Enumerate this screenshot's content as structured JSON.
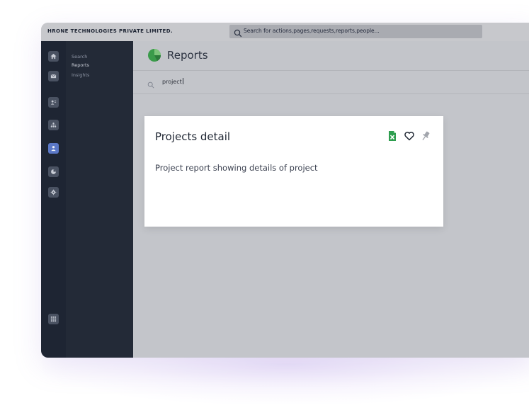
{
  "topbar": {
    "company": "HRONE TECHNOLOGIES PRIVATE LIMITED.",
    "search_placeholder": "Search for actions,pages,requests,reports,people..."
  },
  "rail": {
    "icons": [
      "home-icon",
      "mail-icon",
      "user-card-icon",
      "org-chart-icon",
      "person-icon",
      "pie-chart-icon",
      "settings-icon",
      "apps-grid-icon"
    ],
    "active_index": 4
  },
  "subnav": {
    "items": [
      {
        "label": "Search"
      },
      {
        "label": "Reports"
      },
      {
        "label": "Insights"
      }
    ],
    "active_index": 1
  },
  "page": {
    "title": "Reports"
  },
  "search": {
    "value": "project"
  },
  "card": {
    "title": "Projects detail",
    "description": "Project report showing details of project",
    "actions": [
      "excel-file-icon",
      "heart-icon",
      "pin-icon"
    ]
  },
  "colors": {
    "rail_bg": "#1e2533",
    "subnav_bg": "#232a37",
    "content_bg": "#c3c5ca",
    "accent": "#5b78c7",
    "reports_logo": "#3a9b4a",
    "excel_green": "#2e9e4f"
  }
}
